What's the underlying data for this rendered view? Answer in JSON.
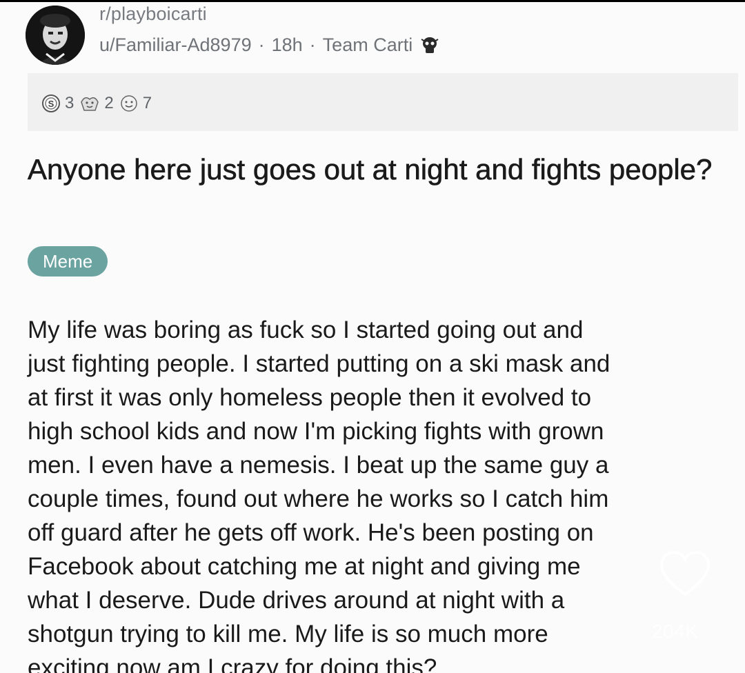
{
  "post": {
    "subreddit": "r/playboicarti",
    "author": "u/Familiar-Ad8979",
    "time": "18h",
    "user_flair": "Team Carti",
    "separator": "·",
    "stats": {
      "awards": "3",
      "gifts": "2",
      "reactions": "7"
    },
    "title": "Anyone here just goes out at night and fights people?",
    "flair": "Meme",
    "body_lines": [
      "My life was boring as fuck so I started going out and",
      "just fighting people. I started putting on a ski mask and",
      "at first it was only homeless people then it evolved to",
      "high school kids and now I'm picking fights with grown",
      "men. I even have a nemesis. I beat up the same guy a",
      "couple times, found out where he works so I catch him",
      "off guard after he gets off work. He's been posting on",
      "Facebook about catching me at night and giving me",
      "what I deserve. Dude drives around at night with a",
      "shotgun trying to kill me. My life is so much more",
      "exciting now am I crazy for doing this?"
    ]
  },
  "overlay": {
    "like_count": "204K",
    "icon": "heart-outline-icon"
  },
  "colors": {
    "background": "#fbfbfb",
    "flair_bg": "#6aa3a0",
    "stats_bar": "#f0f0f0",
    "meta_text": "#6f7378",
    "body_text": "#1a1a1b"
  }
}
